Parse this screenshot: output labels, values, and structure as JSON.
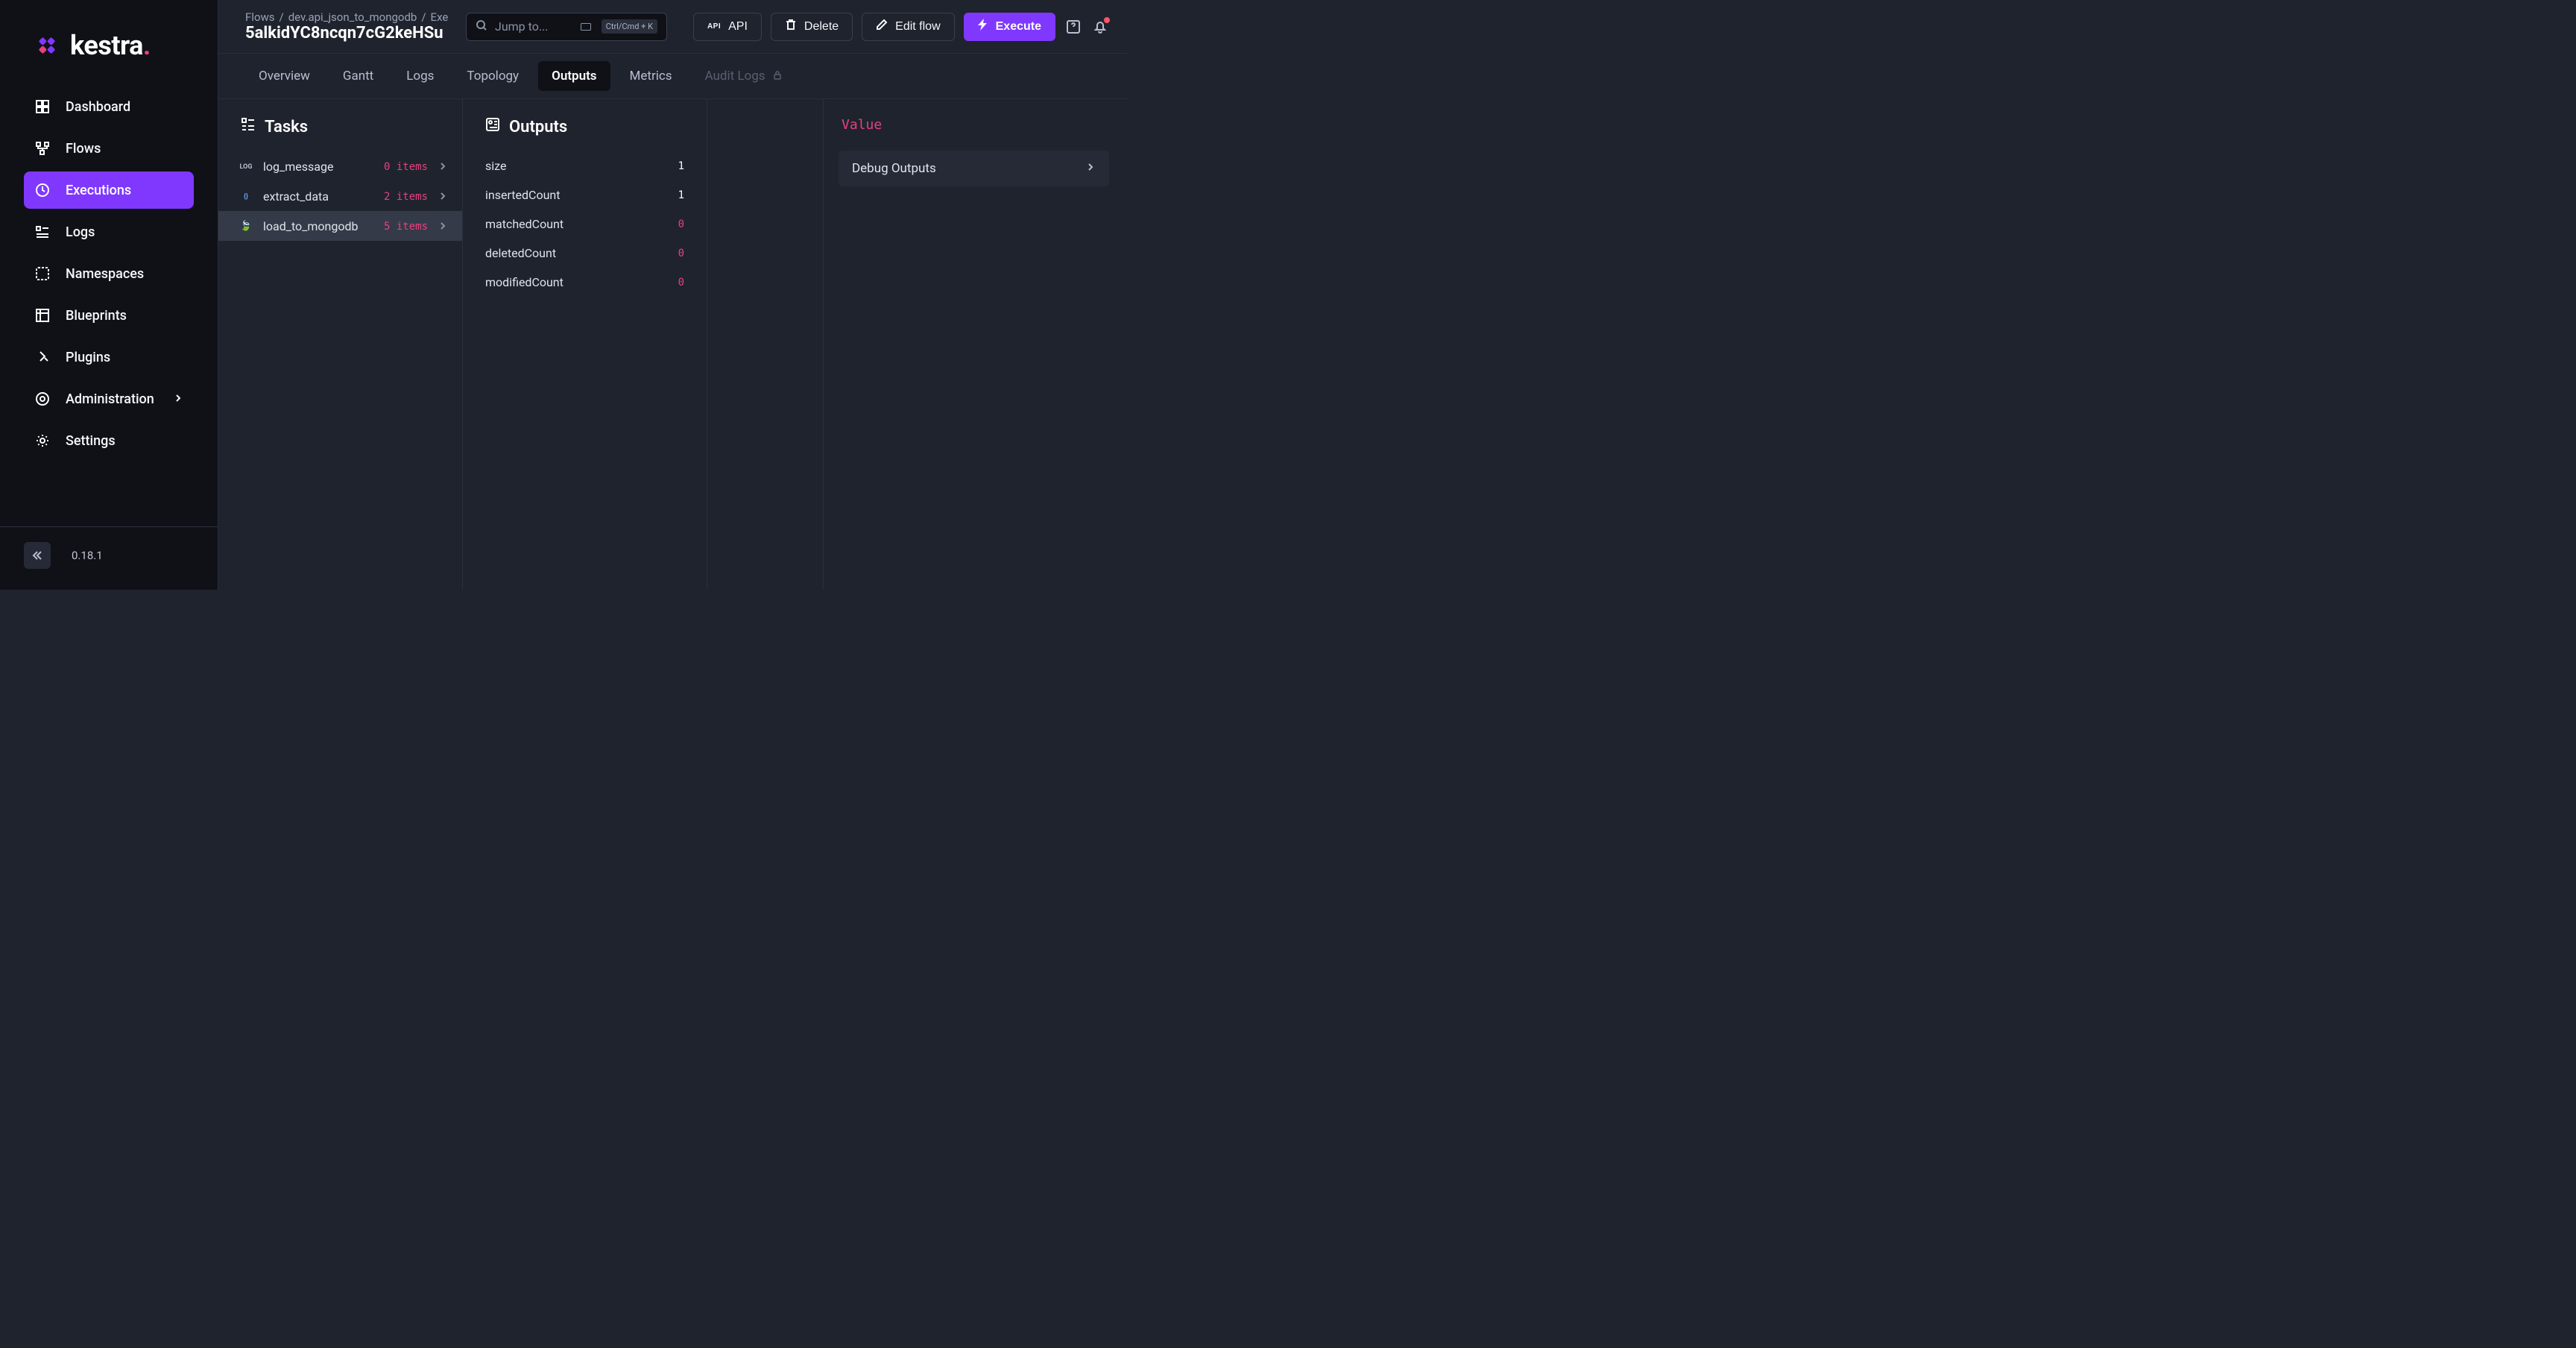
{
  "logo": {
    "text": "kestra",
    "dot": "."
  },
  "sidebar": {
    "items": [
      {
        "label": "Dashboard",
        "icon": "dashboard-icon"
      },
      {
        "label": "Flows",
        "icon": "flows-icon"
      },
      {
        "label": "Executions",
        "icon": "executions-icon"
      },
      {
        "label": "Logs",
        "icon": "logs-icon"
      },
      {
        "label": "Namespaces",
        "icon": "namespaces-icon"
      },
      {
        "label": "Blueprints",
        "icon": "blueprints-icon"
      },
      {
        "label": "Plugins",
        "icon": "plugins-icon"
      },
      {
        "label": "Administration",
        "icon": "administration-icon",
        "expandable": true
      },
      {
        "label": "Settings",
        "icon": "settings-icon"
      }
    ],
    "active_index": 2,
    "version": "0.18.1"
  },
  "breadcrumb": {
    "parts": [
      "Flows",
      "dev.api_json_to_mongodb",
      "Exe"
    ],
    "title": "5alkidYC8ncqn7cG2keHSu"
  },
  "jump": {
    "placeholder": "Jump to...",
    "shortcut": "Ctrl/Cmd + K"
  },
  "header_buttons": {
    "api": "API",
    "delete": "Delete",
    "edit": "Edit flow",
    "execute": "Execute"
  },
  "tabs": {
    "items": [
      {
        "label": "Overview"
      },
      {
        "label": "Gantt"
      },
      {
        "label": "Logs"
      },
      {
        "label": "Topology"
      },
      {
        "label": "Outputs"
      },
      {
        "label": "Metrics"
      },
      {
        "label": "Audit Logs",
        "locked": true
      }
    ],
    "active_index": 4
  },
  "tasks_panel": {
    "title": "Tasks",
    "items": [
      {
        "icon_label": "LOG",
        "name": "log_message",
        "count_text": "0 items"
      },
      {
        "icon_label": "{}",
        "name": "extract_data",
        "count_text": "2 items"
      },
      {
        "icon_label": "🍃",
        "name": "load_to_mongodb",
        "count_text": "5 items"
      }
    ],
    "selected_index": 2
  },
  "outputs_panel": {
    "title": "Outputs",
    "items": [
      {
        "key": "size",
        "value": "1",
        "zero": false
      },
      {
        "key": "insertedCount",
        "value": "1",
        "zero": false
      },
      {
        "key": "matchedCount",
        "value": "0",
        "zero": true
      },
      {
        "key": "deletedCount",
        "value": "0",
        "zero": true
      },
      {
        "key": "modifiedCount",
        "value": "0",
        "zero": true
      }
    ]
  },
  "value_panel": {
    "label": "Value",
    "debug_label": "Debug Outputs"
  }
}
